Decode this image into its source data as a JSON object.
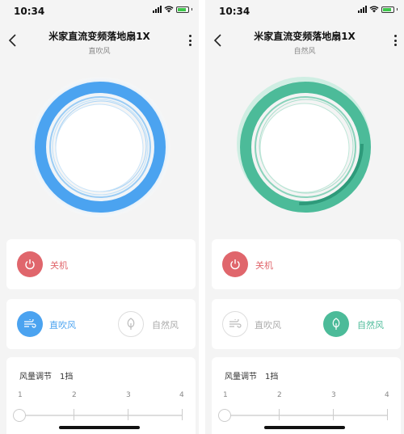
{
  "screens": [
    {
      "time": "10:34",
      "title": "米家直流变频落地扇1X",
      "subtitle": "直吹风",
      "power_label": "关机",
      "mode_a_label": "直吹风",
      "mode_b_label": "自然风",
      "active_mode": "直吹风",
      "speed_title": "风量调节",
      "speed_value": "1挡",
      "speed_ticks": [
        "1",
        "2",
        "3",
        "4"
      ],
      "accent": "#4ba3f0"
    },
    {
      "time": "10:34",
      "title": "米家直流变频落地扇1X",
      "subtitle": "自然风",
      "power_label": "关机",
      "mode_a_label": "直吹风",
      "mode_b_label": "自然风",
      "active_mode": "自然风",
      "speed_title": "风量调节",
      "speed_value": "1挡",
      "speed_ticks": [
        "1",
        "2",
        "3",
        "4"
      ],
      "accent": "#4cbb99"
    }
  ],
  "colors": {
    "power": "#e0666c",
    "blue": "#4ba3f0",
    "green": "#4cbb99"
  },
  "icons": [
    "back-arrow-icon",
    "more-icon",
    "power-icon",
    "wind-icon",
    "leaf-icon"
  ]
}
